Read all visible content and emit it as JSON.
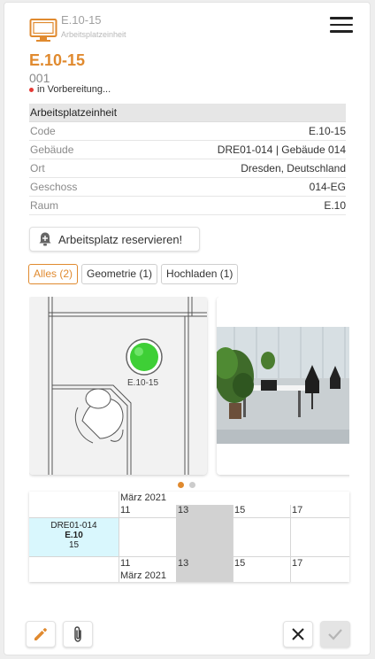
{
  "header": {
    "code": "E.10-15",
    "subtitle": "Arbeitsplatzeinheit",
    "icon": "monitor-icon",
    "menu_icon": "menu-icon",
    "accent": "#e08a2f"
  },
  "entity": {
    "title": "E.10-15",
    "number": "001",
    "status": "in Vorbereitung...",
    "status_color": "#e53935"
  },
  "properties": {
    "header": "Arbeitsplatzeinheit",
    "rows": [
      {
        "label": "Code",
        "value": "E.10-15"
      },
      {
        "label": "Gebäude",
        "value": "DRE01-014 | Gebäude 014"
      },
      {
        "label": "Ort",
        "value": "Dresden, Deutschland"
      },
      {
        "label": "Geschoss",
        "value": "014-EG"
      },
      {
        "label": "Raum",
        "value": "E.10"
      }
    ]
  },
  "actions": {
    "reserve_label": "Arbeitsplatz reservieren!"
  },
  "tabs": [
    {
      "label": "Alles (2)",
      "active": true
    },
    {
      "label": "Geometrie (1)",
      "active": false
    },
    {
      "label": "Hochladen (1)",
      "active": false
    }
  ],
  "gallery": {
    "floorplan_label": "E.10-15",
    "slide_count": 2,
    "active_slide": 0
  },
  "schedule": {
    "month_top": "März 2021",
    "month_bottom": "März 2021",
    "days": [
      "11",
      "13",
      "15",
      "17"
    ],
    "resource": {
      "line1": "DRE01-014",
      "line2": "E.10",
      "line3": "15"
    }
  },
  "footer": {
    "edit_icon": "pencil-icon",
    "attach_icon": "paperclip-icon",
    "cancel_icon": "close-icon",
    "confirm_icon": "check-icon"
  }
}
